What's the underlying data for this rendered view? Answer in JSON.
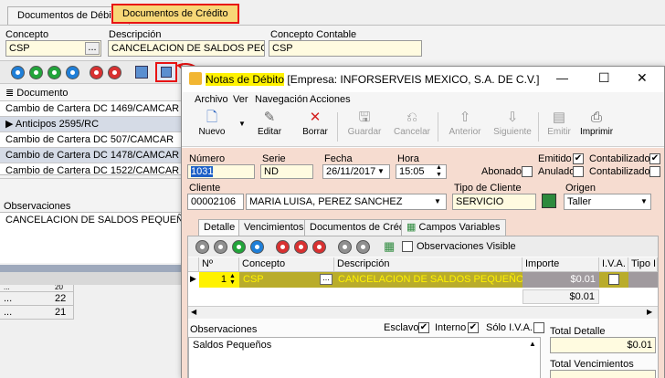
{
  "bg": {
    "tabs": [
      {
        "label": "Documentos de Débito"
      },
      {
        "label": "Documentos de Crédito"
      }
    ],
    "concepto_label": "Concepto",
    "concepto_value": "CSP",
    "descripcion_label": "Descripción",
    "descripcion_value": "CANCELACION DE SALDOS PEQUEÑ",
    "concepto_contable_label": "Concepto Contable",
    "concepto_contable_value": "CSP",
    "ellipsis": "...",
    "doc_header": "Documento",
    "documents": [
      {
        "label": "Cambio de Cartera DC 1469/CAMCAR"
      },
      {
        "label": "Anticipos 2595/RC"
      },
      {
        "label": "Cambio de Cartera DC 507/CAMCAR"
      },
      {
        "label": "Cambio de Cartera DC 1478/CAMCAR"
      },
      {
        "label": "Cambio de Cartera DC 1522/CAMCAR"
      }
    ],
    "observaciones_label": "Observaciones",
    "observaciones_value": "CANCELACION DE SALDOS PEQUEÑOS",
    "lower_rows": [
      {
        "dots": "...",
        "value": "20"
      },
      {
        "dots": "...",
        "value": "22"
      },
      {
        "dots": "...",
        "value": "21"
      }
    ]
  },
  "win": {
    "title_main": "Notas de Débito",
    "title_company": " [Empresa: INFORSERVEIS MEXICO, S.A. DE C.V.]",
    "menu": [
      "Archivo",
      "Ver",
      "Navegación",
      "Acciones"
    ],
    "toolbar": [
      {
        "label": "Nuevo",
        "icon": "new-document-icon",
        "glyph": "🗋"
      },
      {
        "label": "Editar",
        "icon": "edit-icon",
        "glyph": "✎"
      },
      {
        "label": "Borrar",
        "icon": "delete-icon",
        "glyph": "✕"
      },
      {
        "label": "Guardar",
        "icon": "save-icon",
        "glyph": "🖫"
      },
      {
        "label": "Cancelar",
        "icon": "cancel-icon",
        "glyph": "⎌"
      },
      {
        "label": "Anterior",
        "icon": "arrow-up-icon",
        "glyph": "⇧"
      },
      {
        "label": "Siguiente",
        "icon": "arrow-down-icon",
        "glyph": "⇩"
      },
      {
        "label": "Emitir",
        "icon": "emit-icon",
        "glyph": "▤"
      },
      {
        "label": "Imprimir",
        "icon": "print-icon",
        "glyph": "⎙"
      }
    ],
    "numero_label": "Número",
    "numero_value": "1031",
    "serie_label": "Serie",
    "serie_value": "ND",
    "fecha_label": "Fecha",
    "fecha_value": "26/11/2017",
    "hora_label": "Hora",
    "hora_value": "15:05",
    "emitido_label": "Emitido",
    "contabilizado_label": "Contabilizado",
    "abonado_label": "Abonado",
    "anulado_label": "Anulado",
    "contabilizado2_label": "Contabilizado",
    "cliente_label": "Cliente",
    "cliente_code": "00002106",
    "cliente_name": "MARIA LUISA, PEREZ SANCHEZ",
    "tipo_cliente_label": "Tipo de Cliente",
    "tipo_cliente_value": "SERVICIO",
    "origen_label": "Origen",
    "origen_value": "Taller",
    "subtabs": [
      {
        "label": "Detalle"
      },
      {
        "label": "Vencimientos"
      },
      {
        "label": "Documentos de Crédito"
      },
      {
        "label": "Campos Variables"
      }
    ],
    "obs_visible_label": "Observaciones Visible",
    "grid_headers": {
      "n": "Nº",
      "concepto": "Concepto",
      "descripcion": "Descripción",
      "importe": "Importe",
      "iva": "I.V.A.",
      "tipo": "Tipo I."
    },
    "grid_row": {
      "n": "1",
      "concepto": "CSP",
      "ellipsis": "...",
      "descripcion": "CANCELACION DE SALDOS PEQUEÑOS",
      "importe": "$0.01"
    },
    "grid_total": "$0.01",
    "observaciones_label": "Observaciones",
    "observaciones_value": "Saldos Pequeños",
    "esclavo_label": "Esclavo",
    "interno_label": "Interno",
    "solo_iva_label": "Sólo I.V.A.",
    "total_detalle_label": "Total Detalle",
    "total_detalle_value": "$0.01",
    "total_vencimientos_label": "Total Vencimientos",
    "window_min": "—",
    "window_max": "☐",
    "window_close": "✕"
  },
  "colors": {
    "accent_yellow": "#f7d777",
    "red_highlight": "#e81313",
    "selection_olive": "#b9ac2b",
    "panel_pink": "#f6dcd0"
  }
}
